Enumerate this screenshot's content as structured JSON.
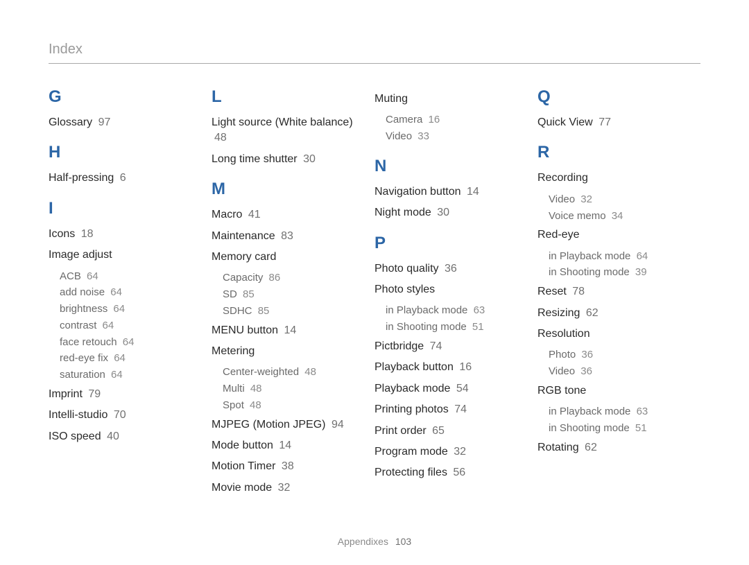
{
  "page_title": "Index",
  "footer": {
    "label": "Appendixes",
    "page": "103"
  },
  "columns": [
    [
      {
        "type": "letter",
        "text": "G"
      },
      {
        "type": "entry",
        "term": "Glossary",
        "page": "97"
      },
      {
        "type": "letter",
        "text": "H"
      },
      {
        "type": "entry",
        "term": "Half-pressing",
        "page": "6"
      },
      {
        "type": "letter",
        "text": "I"
      },
      {
        "type": "entry",
        "term": "Icons",
        "page": "18"
      },
      {
        "type": "entry",
        "term": "Image adjust",
        "page": ""
      },
      {
        "type": "sub",
        "term": "ACB",
        "page": "64"
      },
      {
        "type": "sub",
        "term": "add noise",
        "page": "64"
      },
      {
        "type": "sub",
        "term": "brightness",
        "page": "64"
      },
      {
        "type": "sub",
        "term": "contrast",
        "page": "64"
      },
      {
        "type": "sub",
        "term": "face retouch",
        "page": "64"
      },
      {
        "type": "sub",
        "term": "red-eye fix",
        "page": "64"
      },
      {
        "type": "sub",
        "term": "saturation",
        "page": "64"
      },
      {
        "type": "entry",
        "term": "Imprint",
        "page": "79"
      },
      {
        "type": "entry",
        "term": "Intelli-studio",
        "page": "70"
      },
      {
        "type": "entry",
        "term": "ISO speed",
        "page": "40"
      }
    ],
    [
      {
        "type": "letter",
        "text": "L"
      },
      {
        "type": "entry",
        "term": "Light source (White balance)",
        "page": "48"
      },
      {
        "type": "entry",
        "term": "Long time shutter",
        "page": "30"
      },
      {
        "type": "letter",
        "text": "M"
      },
      {
        "type": "entry",
        "term": "Macro",
        "page": "41"
      },
      {
        "type": "entry",
        "term": "Maintenance",
        "page": "83"
      },
      {
        "type": "entry",
        "term": "Memory card",
        "page": ""
      },
      {
        "type": "sub",
        "term": "Capacity",
        "page": "86"
      },
      {
        "type": "sub",
        "term": "SD",
        "page": "85"
      },
      {
        "type": "sub",
        "term": "SDHC",
        "page": "85"
      },
      {
        "type": "entry",
        "term": "MENU button",
        "page": "14"
      },
      {
        "type": "entry",
        "term": "Metering",
        "page": ""
      },
      {
        "type": "sub",
        "term": "Center-weighted",
        "page": "48"
      },
      {
        "type": "sub",
        "term": "Multi",
        "page": "48"
      },
      {
        "type": "sub",
        "term": "Spot",
        "page": "48"
      },
      {
        "type": "entry",
        "term": "MJPEG (Motion JPEG)",
        "page": "94"
      },
      {
        "type": "entry",
        "term": "Mode button",
        "page": "14"
      },
      {
        "type": "entry",
        "term": "Motion Timer",
        "page": "38"
      },
      {
        "type": "entry",
        "term": "Movie mode",
        "page": "32"
      }
    ],
    [
      {
        "type": "entry",
        "term": "Muting",
        "page": ""
      },
      {
        "type": "sub",
        "term": "Camera",
        "page": "16"
      },
      {
        "type": "sub",
        "term": "Video",
        "page": "33"
      },
      {
        "type": "letter",
        "text": "N"
      },
      {
        "type": "entry",
        "term": "Navigation button",
        "page": "14"
      },
      {
        "type": "entry",
        "term": "Night mode",
        "page": "30"
      },
      {
        "type": "letter",
        "text": "P"
      },
      {
        "type": "entry",
        "term": "Photo quality",
        "page": "36"
      },
      {
        "type": "entry",
        "term": "Photo styles",
        "page": ""
      },
      {
        "type": "sub",
        "term": "in Playback mode",
        "page": "63"
      },
      {
        "type": "sub",
        "term": "in Shooting mode",
        "page": "51"
      },
      {
        "type": "entry",
        "term": "Pictbridge",
        "page": "74"
      },
      {
        "type": "entry",
        "term": "Playback button",
        "page": "16"
      },
      {
        "type": "entry",
        "term": "Playback mode",
        "page": "54"
      },
      {
        "type": "entry",
        "term": "Printing photos",
        "page": "74"
      },
      {
        "type": "entry",
        "term": "Print order",
        "page": "65"
      },
      {
        "type": "entry",
        "term": "Program mode",
        "page": "32"
      },
      {
        "type": "entry",
        "term": "Protecting files",
        "page": "56"
      }
    ],
    [
      {
        "type": "letter",
        "text": "Q"
      },
      {
        "type": "entry",
        "term": "Quick View",
        "page": "77"
      },
      {
        "type": "letter",
        "text": "R"
      },
      {
        "type": "entry",
        "term": "Recording",
        "page": ""
      },
      {
        "type": "sub",
        "term": "Video",
        "page": "32"
      },
      {
        "type": "sub",
        "term": "Voice memo",
        "page": "34"
      },
      {
        "type": "entry",
        "term": "Red-eye",
        "page": ""
      },
      {
        "type": "sub",
        "term": "in Playback mode",
        "page": "64"
      },
      {
        "type": "sub",
        "term": "in Shooting mode",
        "page": "39"
      },
      {
        "type": "entry",
        "term": "Reset",
        "page": "78"
      },
      {
        "type": "entry",
        "term": "Resizing",
        "page": "62"
      },
      {
        "type": "entry",
        "term": "Resolution",
        "page": ""
      },
      {
        "type": "sub",
        "term": "Photo",
        "page": "36"
      },
      {
        "type": "sub",
        "term": "Video",
        "page": "36"
      },
      {
        "type": "entry",
        "term": "RGB tone",
        "page": ""
      },
      {
        "type": "sub",
        "term": "in Playback mode",
        "page": "63"
      },
      {
        "type": "sub",
        "term": "in Shooting mode",
        "page": "51"
      },
      {
        "type": "entry",
        "term": "Rotating",
        "page": "62"
      }
    ]
  ]
}
